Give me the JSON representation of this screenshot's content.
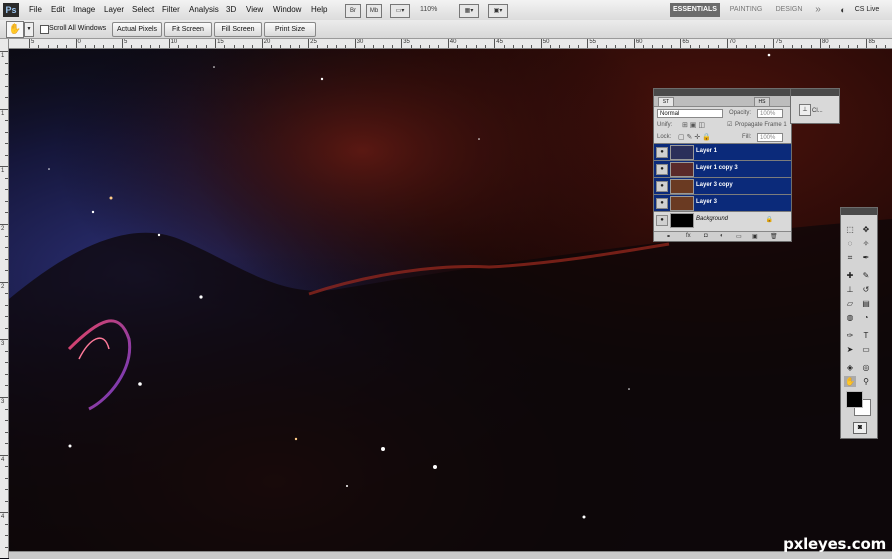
{
  "menu": {
    "app_logo": "Ps",
    "items": [
      "File",
      "Edit",
      "Image",
      "Layer",
      "Select",
      "Filter",
      "Analysis",
      "3D",
      "View",
      "Window",
      "Help"
    ]
  },
  "menubar_icons": {
    "bridge": "Br",
    "minibridge": "Mb",
    "zoom": "110%"
  },
  "workspaces": {
    "essentials": "ESSENTIALS",
    "painting": "PAINTING",
    "design": "DESIGN",
    "more": "»",
    "cslive": "CS Live"
  },
  "options": {
    "scroll_all_label": "Scroll All Windows",
    "buttons": [
      "Actual Pixels",
      "Fit Screen",
      "Fill Screen",
      "Print Size"
    ]
  },
  "ruler": {
    "top": [
      "5",
      "0",
      "5",
      "10",
      "15",
      "20",
      "25",
      "30",
      "35",
      "40",
      "45",
      "50",
      "55",
      "60",
      "65",
      "70",
      "75",
      "80",
      "85"
    ],
    "left": [
      "1",
      "1",
      "1",
      "2",
      "2",
      "3",
      "3",
      "4",
      "4"
    ]
  },
  "layers_panel": {
    "tab_left": "ST",
    "tab_right": "HS",
    "blend_mode": "Normal",
    "opacity_label": "Opacity:",
    "opacity_value": "100%",
    "unify_label": "Unify:",
    "propagate_label": "Propagate Frame 1",
    "lock_label": "Lock:",
    "fill_label": "Fill:",
    "fill_value": "100%",
    "layers": [
      {
        "name": "Layer 1",
        "selected": true
      },
      {
        "name": "Layer 1 copy 3",
        "selected": true
      },
      {
        "name": "Layer 3 copy",
        "selected": true
      },
      {
        "name": "Layer 3",
        "selected": true
      },
      {
        "name": "Background",
        "selected": false
      }
    ]
  },
  "mini_panel": {
    "label": "Cl..."
  },
  "watermark": "pxleyes.com",
  "colors": {
    "accent_selection": "#0b2a7a",
    "workspace_active": "#6b6b6b",
    "nebula_red": "#7a1d14",
    "nebula_blue": "#2a2f7a"
  }
}
